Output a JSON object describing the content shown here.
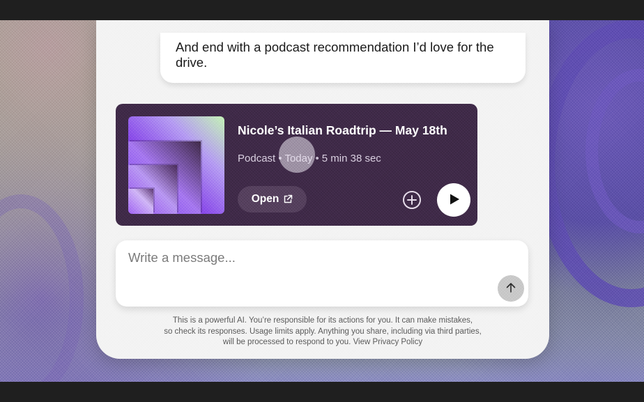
{
  "conversation": {
    "user_message_line1": "And end with a podcast recommendation I’d love for the",
    "user_message_line2": "drive."
  },
  "podcast_card": {
    "title": "Nicole’s Italian Roadtrip — May 18th",
    "type": "Podcast",
    "date": "Today",
    "duration": "5 min 38 sec",
    "separator": "•",
    "open_label": "Open",
    "icons": {
      "open": "external-link-icon",
      "add": "plus-circle-icon",
      "play": "play-icon"
    },
    "colors": {
      "card_background": "#3f2a48",
      "cover_primary": "#7c3df0",
      "cover_accent": "#c4f2b6"
    }
  },
  "composer": {
    "placeholder": "Write a message...",
    "value": "",
    "send_icon": "arrow-up-icon"
  },
  "disclaimer": {
    "line1": "This is a powerful AI. You’re responsible for its actions for you. It can make mistakes,",
    "line2": "so check its responses. Usage limits apply. Anything you share, including via third parties,",
    "line3_text": "will be processed to respond to you.",
    "privacy_link": "View Privacy Policy"
  }
}
